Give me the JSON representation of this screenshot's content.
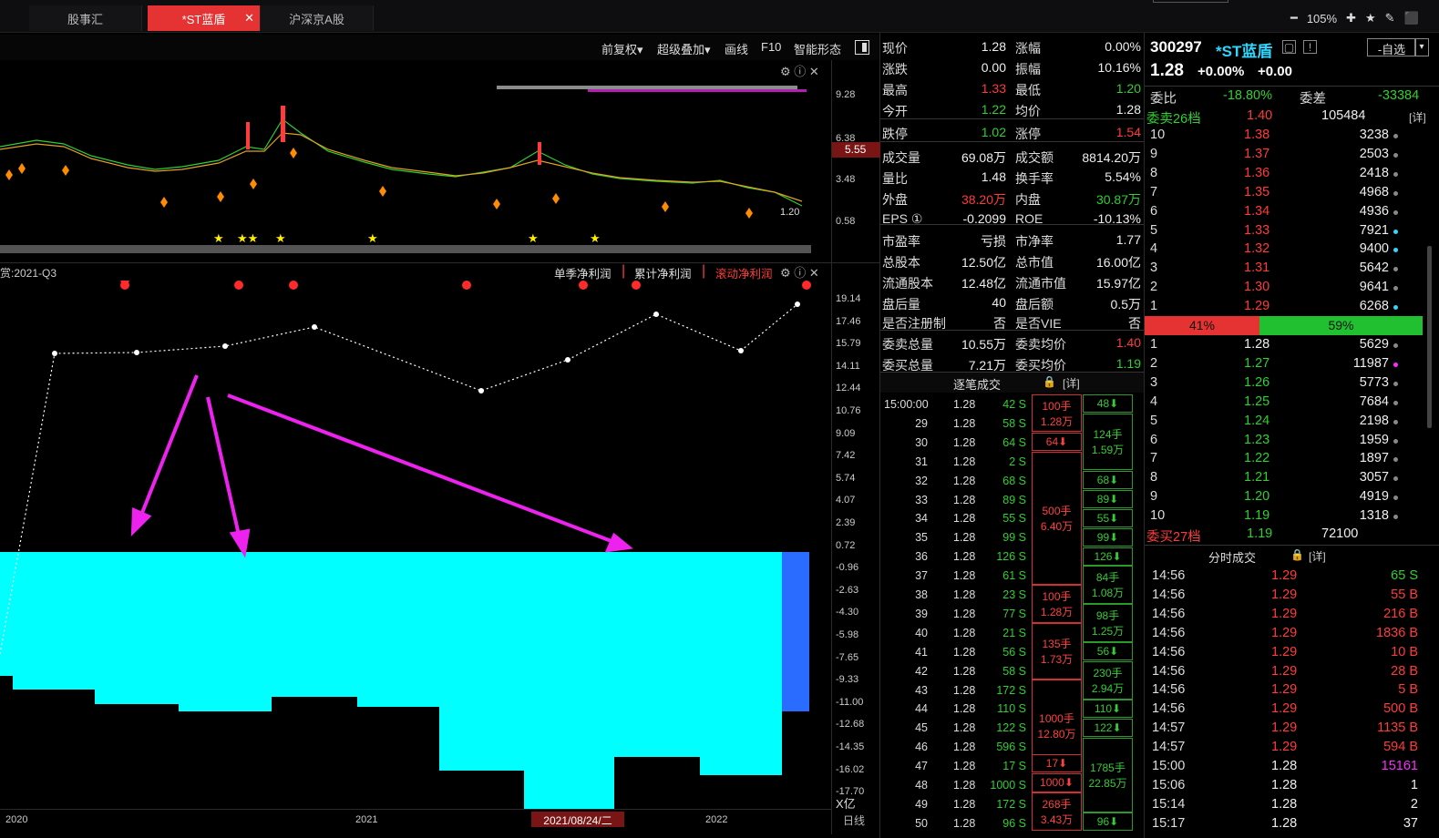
{
  "tabs": [
    {
      "label": "股事汇",
      "active": false
    },
    {
      "label": "*ST蓝盾",
      "active": true
    },
    {
      "label": "沪深京A股",
      "active": false
    }
  ],
  "zoom": "105%",
  "chart_toolbar": {
    "adjust": "前复权▾",
    "overlay": "超级叠加▾",
    "draw": "画线",
    "f10": "F10",
    "smart": "智能形态"
  },
  "kline": {
    "price_tag": "5.55",
    "low_label": "1.20",
    "y_ticks": [
      "9.28",
      "6.38",
      "3.48",
      "0.58"
    ]
  },
  "profit_panel": {
    "period_label": "赏:2021-Q3",
    "tabs": [
      "单季净利润",
      "累计净利润",
      "滚动净利润"
    ],
    "y_ticks": [
      "19.14",
      "17.46",
      "15.79",
      "14.11",
      "12.44",
      "10.76",
      "9.09",
      "7.42",
      "5.74",
      "4.07",
      "2.39",
      "0.72",
      "-0.96",
      "-2.63",
      "-4.30",
      "-5.98",
      "-7.65",
      "-9.33",
      "-11.00",
      "-12.68",
      "-14.35",
      "-16.02",
      "-17.70"
    ],
    "unit": "X亿"
  },
  "x_axis": {
    "labels": [
      "2020",
      "2021",
      "2022"
    ],
    "cursor_date": "2021/08/24/二",
    "period": "日线"
  },
  "quote": {
    "rows": [
      [
        "现价",
        "1.28",
        "涨幅",
        "0.00%"
      ],
      [
        "涨跌",
        "0.00",
        "振幅",
        "10.16%"
      ],
      [
        "最高",
        "1.33",
        "最低",
        "1.20"
      ],
      [
        "今开",
        "1.22",
        "均价",
        "1.28"
      ],
      [
        "跌停",
        "1.02",
        "涨停",
        "1.54"
      ],
      [
        "成交量",
        "69.08万",
        "成交额",
        "8814.20万"
      ],
      [
        "量比",
        "1.48",
        "换手率",
        "5.54%"
      ],
      [
        "外盘",
        "38.20万",
        "内盘",
        "30.87万"
      ],
      [
        "EPS ①",
        "-0.2099",
        "ROE",
        "-10.13%"
      ],
      [
        "市盈率",
        "亏损",
        "市净率",
        "1.77"
      ],
      [
        "总股本",
        "12.50亿",
        "总市值",
        "16.00亿"
      ],
      [
        "流通股本",
        "12.48亿",
        "流通市值",
        "15.97亿"
      ],
      [
        "盘后量",
        "40",
        "盘后额",
        "0.5万"
      ],
      [
        "是否注册制",
        "否",
        "是否VIE",
        "否"
      ],
      [
        "委卖总量",
        "10.55万",
        "委卖均价",
        "1.40"
      ],
      [
        "委买总量",
        "7.21万",
        "委买均价",
        "1.19"
      ]
    ]
  },
  "trades": {
    "title": "逐笔成交",
    "detail": "[详]",
    "rows": [
      [
        "15:00:00",
        "1.28",
        "42 S"
      ],
      [
        "29",
        "1.28",
        "58 S"
      ],
      [
        "30",
        "1.28",
        "64 S"
      ],
      [
        "31",
        "1.28",
        "2 S"
      ],
      [
        "32",
        "1.28",
        "68 S"
      ],
      [
        "33",
        "1.28",
        "89 S"
      ],
      [
        "34",
        "1.28",
        "55 S"
      ],
      [
        "35",
        "1.28",
        "99 S"
      ],
      [
        "36",
        "1.28",
        "126 S"
      ],
      [
        "37",
        "1.28",
        "61 S"
      ],
      [
        "38",
        "1.28",
        "23 S"
      ],
      [
        "39",
        "1.28",
        "77 S"
      ],
      [
        "40",
        "1.28",
        "21 S"
      ],
      [
        "41",
        "1.28",
        "56 S"
      ],
      [
        "42",
        "1.28",
        "58 S"
      ],
      [
        "43",
        "1.28",
        "172 S"
      ],
      [
        "44",
        "1.28",
        "110 S"
      ],
      [
        "45",
        "1.28",
        "122 S"
      ],
      [
        "46",
        "1.28",
        "596 S"
      ],
      [
        "47",
        "1.28",
        "17 S"
      ],
      [
        "48",
        "1.28",
        "1000 S"
      ],
      [
        "49",
        "1.28",
        "172 S"
      ],
      [
        "50",
        "1.28",
        "96 S"
      ]
    ],
    "sell_boxes": [
      [
        "100手",
        "1.28万"
      ],
      [
        "64⬇",
        ""
      ],
      [
        "500手",
        "6.40万"
      ],
      [
        "100手",
        "1.28万"
      ],
      [
        "135手",
        "1.73万"
      ],
      [
        "1000手",
        "12.80万"
      ],
      [
        "17⬇",
        ""
      ],
      [
        "1000⬇",
        ""
      ],
      [
        "268手",
        "3.43万"
      ]
    ],
    "buy_boxes": [
      [
        "48⬇",
        ""
      ],
      [
        "124手",
        "1.59万"
      ],
      [
        "68⬇",
        ""
      ],
      [
        "89⬇",
        ""
      ],
      [
        "55⬇",
        ""
      ],
      [
        "99⬇",
        ""
      ],
      [
        "126⬇",
        ""
      ],
      [
        "84手",
        "1.08万"
      ],
      [
        "98手",
        "1.25万"
      ],
      [
        "56⬇",
        ""
      ],
      [
        "230手",
        "2.94万"
      ],
      [
        "110⬇",
        ""
      ],
      [
        "122⬇",
        ""
      ],
      [
        "1785手",
        "22.85万"
      ],
      [
        "96⬇",
        ""
      ]
    ]
  },
  "stock": {
    "code": "300297",
    "name": "*ST蓝盾",
    "price": "1.28",
    "pct": "+0.00%",
    "chg": "+0.00",
    "watch_btn": "-自选"
  },
  "orderbook": {
    "weibi_label": "委比",
    "weibi": "-18.80%",
    "weicha_label": "委差",
    "weicha": "-33384",
    "sell_head": [
      "委卖26档",
      "1.40",
      "105484",
      "[详]"
    ],
    "sells": [
      [
        "10",
        "1.38",
        "3238"
      ],
      [
        "9",
        "1.37",
        "2503"
      ],
      [
        "8",
        "1.36",
        "2418"
      ],
      [
        "7",
        "1.35",
        "4968"
      ],
      [
        "6",
        "1.34",
        "4936"
      ],
      [
        "5",
        "1.33",
        "7921"
      ],
      [
        "4",
        "1.32",
        "9400"
      ],
      [
        "3",
        "1.31",
        "5642"
      ],
      [
        "2",
        "1.30",
        "9641"
      ],
      [
        "1",
        "1.29",
        "6268"
      ]
    ],
    "ratio_sell": "41%",
    "ratio_buy": "59%",
    "buys": [
      [
        "1",
        "1.28",
        "5629"
      ],
      [
        "2",
        "1.27",
        "11987"
      ],
      [
        "3",
        "1.26",
        "5773"
      ],
      [
        "4",
        "1.25",
        "7684"
      ],
      [
        "5",
        "1.24",
        "2198"
      ],
      [
        "6",
        "1.23",
        "1959"
      ],
      [
        "7",
        "1.22",
        "1897"
      ],
      [
        "8",
        "1.21",
        "3057"
      ],
      [
        "9",
        "1.20",
        "4919"
      ],
      [
        "10",
        "1.19",
        "1318"
      ]
    ],
    "buy_head": [
      "委买27档",
      "1.19",
      "72100"
    ]
  },
  "ticks": {
    "title": "分时成交",
    "detail": "[详]",
    "rows": [
      [
        "14:56",
        "1.29",
        "65 S"
      ],
      [
        "14:56",
        "1.29",
        "55 B"
      ],
      [
        "14:56",
        "1.29",
        "216 B"
      ],
      [
        "14:56",
        "1.29",
        "1836 B"
      ],
      [
        "14:56",
        "1.29",
        "10 B"
      ],
      [
        "14:56",
        "1.29",
        "28 B"
      ],
      [
        "14:56",
        "1.29",
        "5 B"
      ],
      [
        "14:56",
        "1.29",
        "500 B"
      ],
      [
        "14:57",
        "1.29",
        "1135 B"
      ],
      [
        "14:57",
        "1.29",
        "594 B"
      ],
      [
        "15:00",
        "1.28",
        "15161"
      ],
      [
        "15:06",
        "1.28",
        "1"
      ],
      [
        "15:14",
        "1.28",
        "2"
      ],
      [
        "15:17",
        "1.28",
        "37"
      ]
    ]
  },
  "colors": {
    "up": "#ff3b3b",
    "down": "#2fd02f",
    "cyan_fill": "#00ffff",
    "blue_fill": "#2a6cff",
    "arrow": "#ee22ee"
  }
}
